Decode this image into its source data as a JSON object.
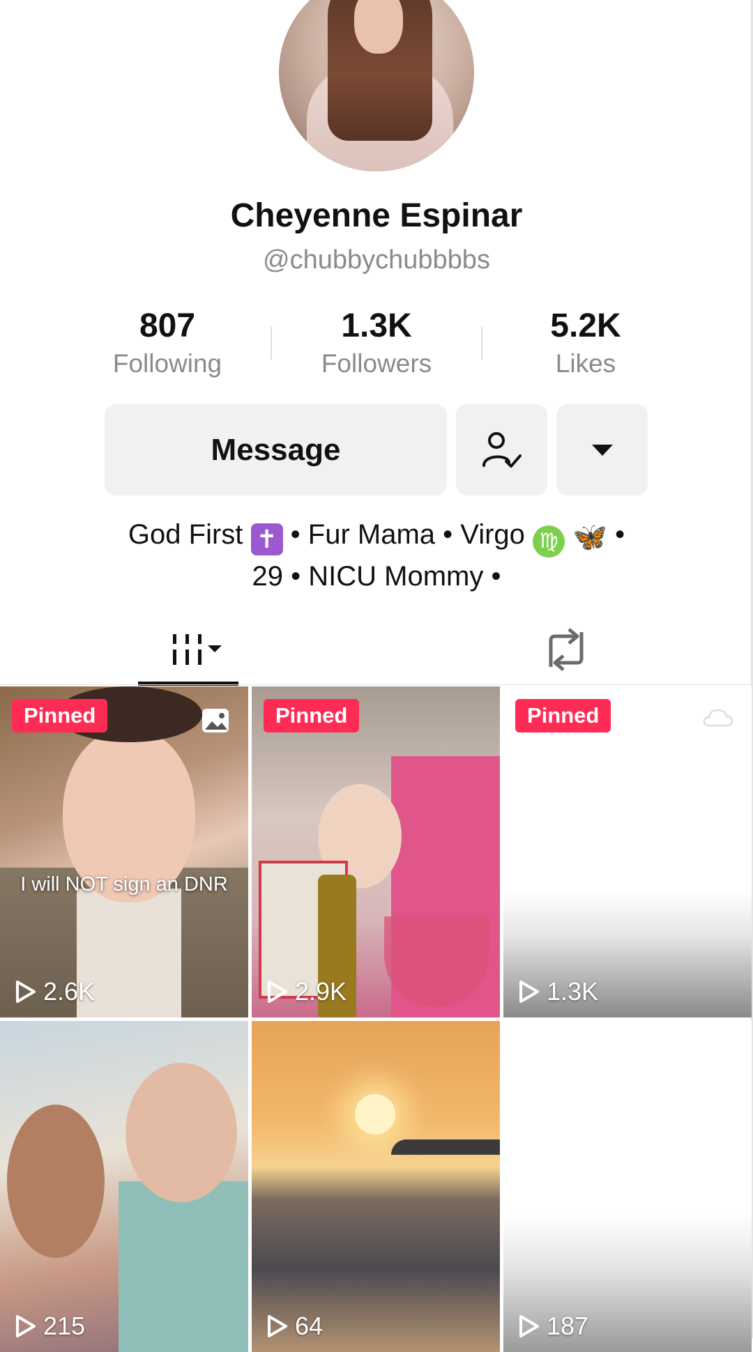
{
  "profile": {
    "display_name": "Cheyenne Espinar",
    "handle": "@chubbychubbbbs",
    "stats": [
      {
        "value": "807",
        "label": "Following"
      },
      {
        "value": "1.3K",
        "label": "Followers"
      },
      {
        "value": "5.2K",
        "label": "Likes"
      }
    ],
    "bio": {
      "line1_a": "God First",
      "line1_b": " • Fur Mama • Virgo ",
      "line1_c": " •",
      "line2": "29 • NICU Mommy •"
    }
  },
  "actions": {
    "message_label": "Message",
    "follow_icon": "user-check-icon",
    "more_icon": "caret-down-icon"
  },
  "tabs": {
    "videos_icon": "grid-icon",
    "reposts_icon": "repost-icon"
  },
  "videos": [
    {
      "pinned_label": "Pinned",
      "views": "2.6K",
      "overlay_text": "I will NOT sign an DNR",
      "type_icon": "photo-icon"
    },
    {
      "pinned_label": "Pinned",
      "views": "2.9K"
    },
    {
      "pinned_label": "Pinned",
      "views": "1.3K",
      "type_icon": "cloud-icon"
    },
    {
      "views": "215"
    },
    {
      "views": "64"
    },
    {
      "views": "187"
    }
  ],
  "colors": {
    "pinned_badge": "#fe2c55",
    "button_bg": "#f1f1f2",
    "secondary_text": "#8a8a8a"
  }
}
